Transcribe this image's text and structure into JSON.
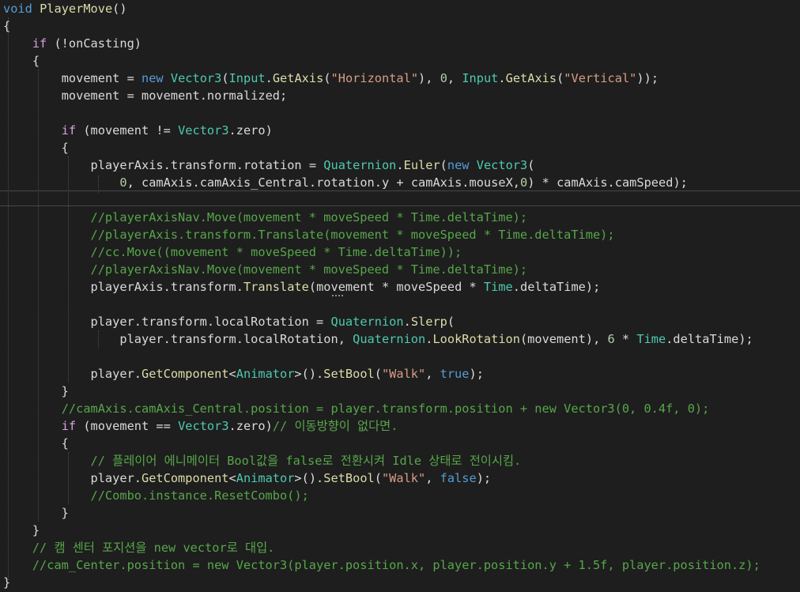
{
  "colors": {
    "background": "#1e1e1e",
    "keyword": "#569cd6",
    "control": "#d8a0df",
    "type": "#4ec9b0",
    "method": "#dcdcaa",
    "variable": "#dadada",
    "string": "#d69d85",
    "number": "#b5cea8",
    "comment": "#57a64a"
  },
  "code_lines": [
    [
      [
        "kw",
        "void"
      ],
      [
        "p",
        " "
      ],
      [
        "m",
        "PlayerMove"
      ],
      [
        "p",
        "()"
      ]
    ],
    [
      [
        "p",
        "{"
      ]
    ],
    [
      [
        "p",
        "    "
      ],
      [
        "c",
        "if"
      ],
      [
        "p",
        " (!"
      ],
      [
        "v",
        "onCasting"
      ],
      [
        "p",
        ")"
      ]
    ],
    [
      [
        "p",
        "    {"
      ]
    ],
    [
      [
        "p",
        "        "
      ],
      [
        "v",
        "movement"
      ],
      [
        "p",
        " = "
      ],
      [
        "kw",
        "new"
      ],
      [
        "p",
        " "
      ],
      [
        "t",
        "Vector3"
      ],
      [
        "p",
        "("
      ],
      [
        "t",
        "Input"
      ],
      [
        "p",
        "."
      ],
      [
        "m",
        "GetAxis"
      ],
      [
        "p",
        "("
      ],
      [
        "s",
        "\"Horizontal\""
      ],
      [
        "p",
        "), "
      ],
      [
        "n",
        "0"
      ],
      [
        "p",
        ", "
      ],
      [
        "t",
        "Input"
      ],
      [
        "p",
        "."
      ],
      [
        "m",
        "GetAxis"
      ],
      [
        "p",
        "("
      ],
      [
        "s",
        "\"Vertical\""
      ],
      [
        "p",
        "));"
      ]
    ],
    [
      [
        "p",
        "        "
      ],
      [
        "v",
        "movement"
      ],
      [
        "p",
        " = "
      ],
      [
        "v",
        "movement"
      ],
      [
        "p",
        "."
      ],
      [
        "v",
        "normalized"
      ],
      [
        "p",
        ";"
      ]
    ],
    [
      [
        "p",
        ""
      ]
    ],
    [
      [
        "p",
        "        "
      ],
      [
        "c",
        "if"
      ],
      [
        "p",
        " ("
      ],
      [
        "v",
        "movement"
      ],
      [
        "p",
        " != "
      ],
      [
        "t",
        "Vector3"
      ],
      [
        "p",
        "."
      ],
      [
        "v",
        "zero"
      ],
      [
        "p",
        ")"
      ]
    ],
    [
      [
        "p",
        "        {"
      ]
    ],
    [
      [
        "p",
        "            "
      ],
      [
        "v",
        "playerAxis"
      ],
      [
        "p",
        "."
      ],
      [
        "v",
        "transform"
      ],
      [
        "p",
        "."
      ],
      [
        "v",
        "rotation"
      ],
      [
        "p",
        " = "
      ],
      [
        "t",
        "Quaternion"
      ],
      [
        "p",
        "."
      ],
      [
        "m",
        "Euler"
      ],
      [
        "p",
        "("
      ],
      [
        "kw",
        "new"
      ],
      [
        "p",
        " "
      ],
      [
        "t",
        "Vector3"
      ],
      [
        "p",
        "("
      ]
    ],
    [
      [
        "p",
        "                "
      ],
      [
        "n",
        "0"
      ],
      [
        "p",
        ", "
      ],
      [
        "v",
        "camAxis"
      ],
      [
        "p",
        "."
      ],
      [
        "v",
        "camAxis_Central"
      ],
      [
        "p",
        "."
      ],
      [
        "v",
        "rotation"
      ],
      [
        "p",
        "."
      ],
      [
        "v",
        "y"
      ],
      [
        "p",
        " + "
      ],
      [
        "v",
        "camAxis"
      ],
      [
        "p",
        "."
      ],
      [
        "v",
        "mouseX"
      ],
      [
        "p",
        ","
      ],
      [
        "n",
        "0"
      ],
      [
        "p",
        ") * "
      ],
      [
        "v",
        "camAxis"
      ],
      [
        "p",
        "."
      ],
      [
        "v",
        "camSpeed"
      ],
      [
        "p",
        ");"
      ]
    ],
    [
      [
        "p",
        ""
      ]
    ],
    [
      [
        "p",
        "            "
      ],
      [
        "cm",
        "//playerAxisNav.Move(movement * moveSpeed * Time.deltaTime);"
      ]
    ],
    [
      [
        "p",
        "            "
      ],
      [
        "cm",
        "//playerAxis.transform.Translate(movement * moveSpeed * Time.deltaTime);"
      ]
    ],
    [
      [
        "p",
        "            "
      ],
      [
        "cm",
        "//cc.Move((movement * moveSpeed * Time.deltaTime));"
      ]
    ],
    [
      [
        "p",
        "            "
      ],
      [
        "cm",
        "//playerAxisNav.Move(movement * moveSpeed * Time.deltaTime);"
      ]
    ],
    [
      [
        "p",
        "            "
      ],
      [
        "v",
        "playerAxis"
      ],
      [
        "p",
        "."
      ],
      [
        "v",
        "transform"
      ],
      [
        "p",
        "."
      ],
      [
        "m",
        "Translate"
      ],
      [
        "p",
        "("
      ],
      [
        "v",
        "movement"
      ],
      [
        "p",
        " * "
      ],
      [
        "v",
        "moveSpeed"
      ],
      [
        "p",
        " * "
      ],
      [
        "t",
        "Time"
      ],
      [
        "p",
        "."
      ],
      [
        "v",
        "deltaTime"
      ],
      [
        "p",
        ");"
      ]
    ],
    [
      [
        "p",
        ""
      ]
    ],
    [
      [
        "p",
        "            "
      ],
      [
        "v",
        "player"
      ],
      [
        "p",
        "."
      ],
      [
        "v",
        "transform"
      ],
      [
        "p",
        "."
      ],
      [
        "v",
        "localRotation"
      ],
      [
        "p",
        " = "
      ],
      [
        "t",
        "Quaternion"
      ],
      [
        "p",
        "."
      ],
      [
        "m",
        "Slerp"
      ],
      [
        "p",
        "("
      ]
    ],
    [
      [
        "p",
        "                "
      ],
      [
        "v",
        "player"
      ],
      [
        "p",
        "."
      ],
      [
        "v",
        "transform"
      ],
      [
        "p",
        "."
      ],
      [
        "v",
        "localRotation"
      ],
      [
        "p",
        ", "
      ],
      [
        "t",
        "Quaternion"
      ],
      [
        "p",
        "."
      ],
      [
        "m",
        "LookRotation"
      ],
      [
        "p",
        "("
      ],
      [
        "v",
        "movement"
      ],
      [
        "p",
        "), "
      ],
      [
        "n",
        "6"
      ],
      [
        "p",
        " * "
      ],
      [
        "t",
        "Time"
      ],
      [
        "p",
        "."
      ],
      [
        "v",
        "deltaTime"
      ],
      [
        "p",
        ");"
      ]
    ],
    [
      [
        "p",
        ""
      ]
    ],
    [
      [
        "p",
        "            "
      ],
      [
        "v",
        "player"
      ],
      [
        "p",
        "."
      ],
      [
        "m",
        "GetComponent"
      ],
      [
        "p",
        "<"
      ],
      [
        "t",
        "Animator"
      ],
      [
        "p",
        ">()."
      ],
      [
        "m",
        "SetBool"
      ],
      [
        "p",
        "("
      ],
      [
        "s",
        "\"Walk\""
      ],
      [
        "p",
        ", "
      ],
      [
        "kw",
        "true"
      ],
      [
        "p",
        ");"
      ]
    ],
    [
      [
        "p",
        "        }"
      ]
    ],
    [
      [
        "p",
        "        "
      ],
      [
        "cm",
        "//camAxis.camAxis_Central.position = player.transform.position + new Vector3(0, 0.4f, 0);"
      ]
    ],
    [
      [
        "p",
        "        "
      ],
      [
        "c",
        "if"
      ],
      [
        "p",
        " ("
      ],
      [
        "v",
        "movement"
      ],
      [
        "p",
        " == "
      ],
      [
        "t",
        "Vector3"
      ],
      [
        "p",
        "."
      ],
      [
        "v",
        "zero"
      ],
      [
        "p",
        ")"
      ],
      [
        "cm",
        "// 이동방향이 없다면."
      ]
    ],
    [
      [
        "p",
        "        {"
      ]
    ],
    [
      [
        "p",
        "            "
      ],
      [
        "cm",
        "// 플레이어 에니메이터 Bool값을 false로 전환시켜 Idle 상태로 전이시킴."
      ]
    ],
    [
      [
        "p",
        "            "
      ],
      [
        "v",
        "player"
      ],
      [
        "p",
        "."
      ],
      [
        "m",
        "GetComponent"
      ],
      [
        "p",
        "<"
      ],
      [
        "t",
        "Animator"
      ],
      [
        "p",
        ">()."
      ],
      [
        "m",
        "SetBool"
      ],
      [
        "p",
        "("
      ],
      [
        "s",
        "\"Walk\""
      ],
      [
        "p",
        ", "
      ],
      [
        "kw",
        "false"
      ],
      [
        "p",
        ");"
      ]
    ],
    [
      [
        "p",
        "            "
      ],
      [
        "cm",
        "//Combo.instance.ResetCombo();"
      ]
    ],
    [
      [
        "p",
        "        }"
      ]
    ],
    [
      [
        "p",
        "    }"
      ]
    ],
    [
      [
        "p",
        "    "
      ],
      [
        "cm",
        "// 캠 센터 포지션을 new vector로 대입."
      ]
    ],
    [
      [
        "p",
        "    "
      ],
      [
        "cm",
        "//cam_Center.position = new Vector3(player.position.x, player.position.y + 1.5f, player.position.z);"
      ]
    ],
    [
      [
        "p",
        "}"
      ]
    ],
    [
      [
        "p",
        ""
      ]
    ]
  ]
}
